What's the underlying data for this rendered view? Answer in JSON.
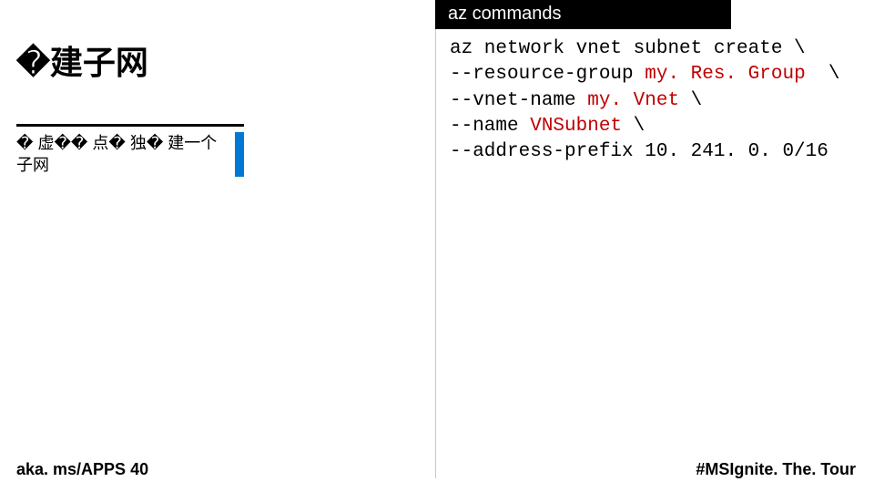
{
  "title": "�建子网",
  "subtitle": "� 虚�� 点� 独� 建一个子网",
  "terminal_header": "az commands",
  "code": {
    "l1a": "az network vnet subnet create \\",
    "l2a": "--resource-group ",
    "l2b": "my. Res. Group ",
    "l2c": " \\",
    "l3a": "--vnet-name ",
    "l3b": "my. Vnet",
    "l3c": " \\",
    "l4a": "--name ",
    "l4b": "VNSubnet",
    "l4c": " \\",
    "l5a": "--address-prefix 10. 241. 0. 0/16"
  },
  "link": "aka. ms/APPS 40",
  "hashtag": "#MSIgnite. The. Tour"
}
